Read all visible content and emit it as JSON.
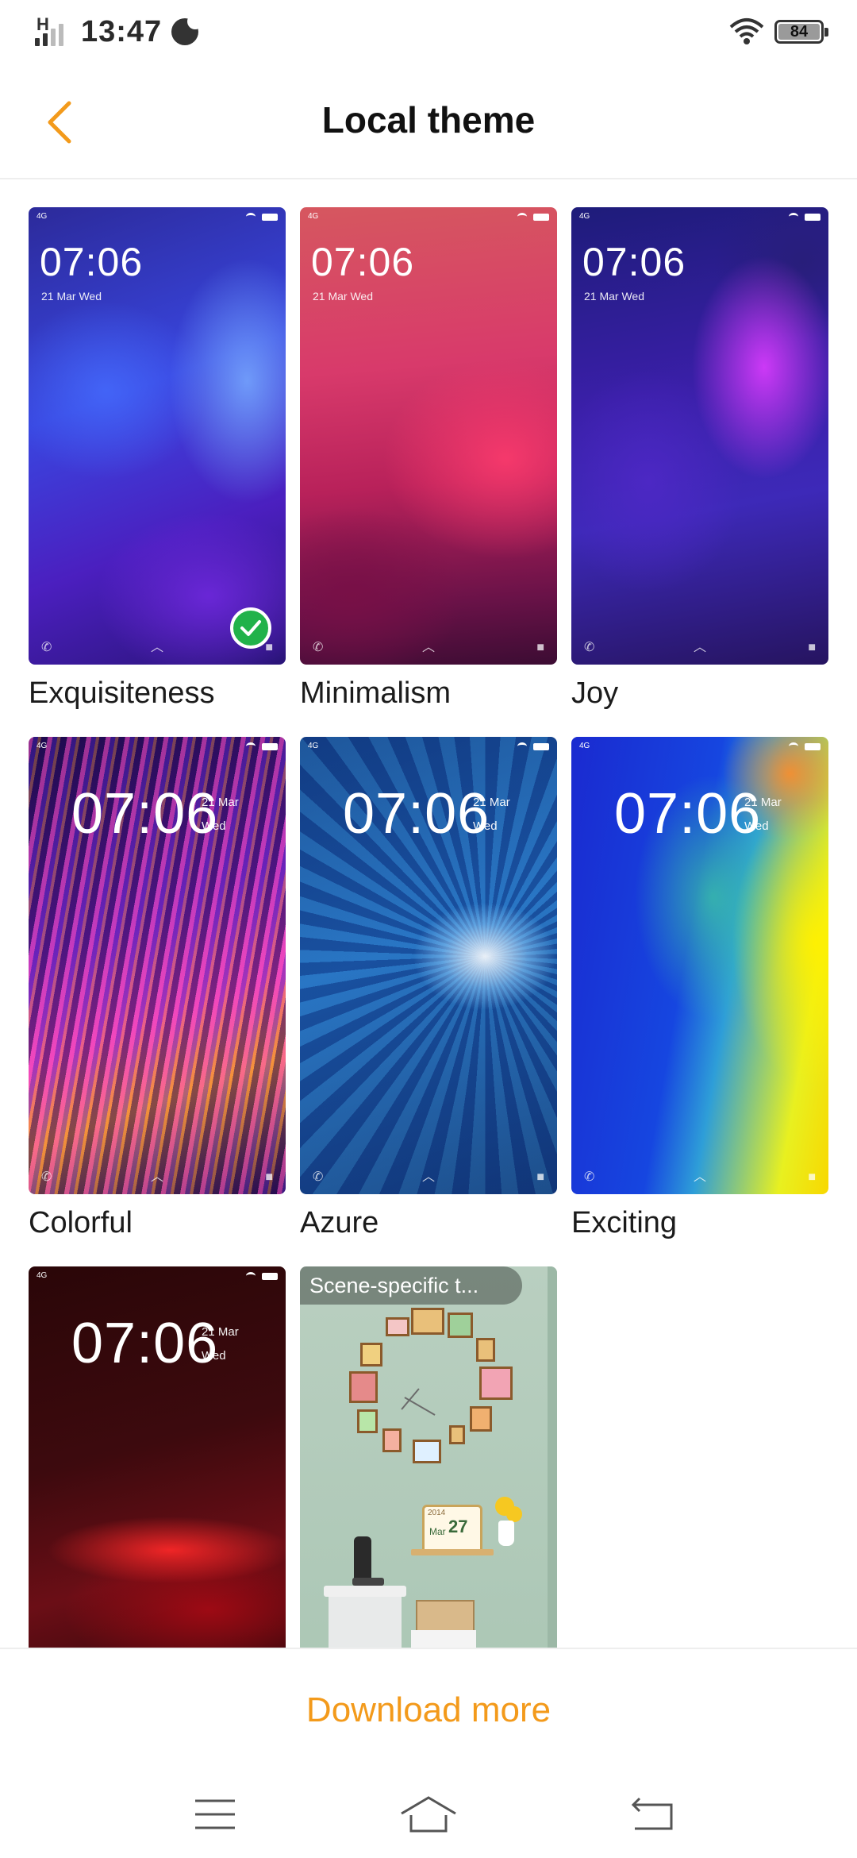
{
  "status_bar": {
    "network": "H",
    "time": "13:47",
    "battery": "84"
  },
  "header": {
    "title": "Local theme"
  },
  "themes": [
    {
      "name": "Exquisiteness",
      "time": "07:06",
      "date": "21 Mar Wed",
      "selected": true
    },
    {
      "name": "Minimalism",
      "time": "07:06",
      "date": "21 Mar Wed"
    },
    {
      "name": "Joy",
      "time": "07:06",
      "date": "21 Mar Wed"
    },
    {
      "name": "Colorful",
      "time": "07:06",
      "date_day": "21 Mar",
      "date_wd": "Wed"
    },
    {
      "name": "Azure",
      "time": "07:06",
      "date_day": "21 Mar",
      "date_wd": "Wed"
    },
    {
      "name": "Exciting",
      "time": "07:06",
      "date_day": "21 Mar",
      "date_wd": "Wed"
    },
    {
      "name": "",
      "time": "07:06",
      "date_day": "21 Mar",
      "date_wd": "Wed"
    },
    {
      "name": "",
      "badge": "Scene-specific t...",
      "cal_year": "2014",
      "cal_month": "Mar",
      "cal_day": "27"
    }
  ],
  "footer": {
    "download_label": "Download more"
  },
  "colors": {
    "accent": "#f39a1b",
    "selected_check": "#21b24a"
  },
  "nav": {
    "icons": [
      "menu-icon",
      "home-icon",
      "back-icon"
    ]
  }
}
